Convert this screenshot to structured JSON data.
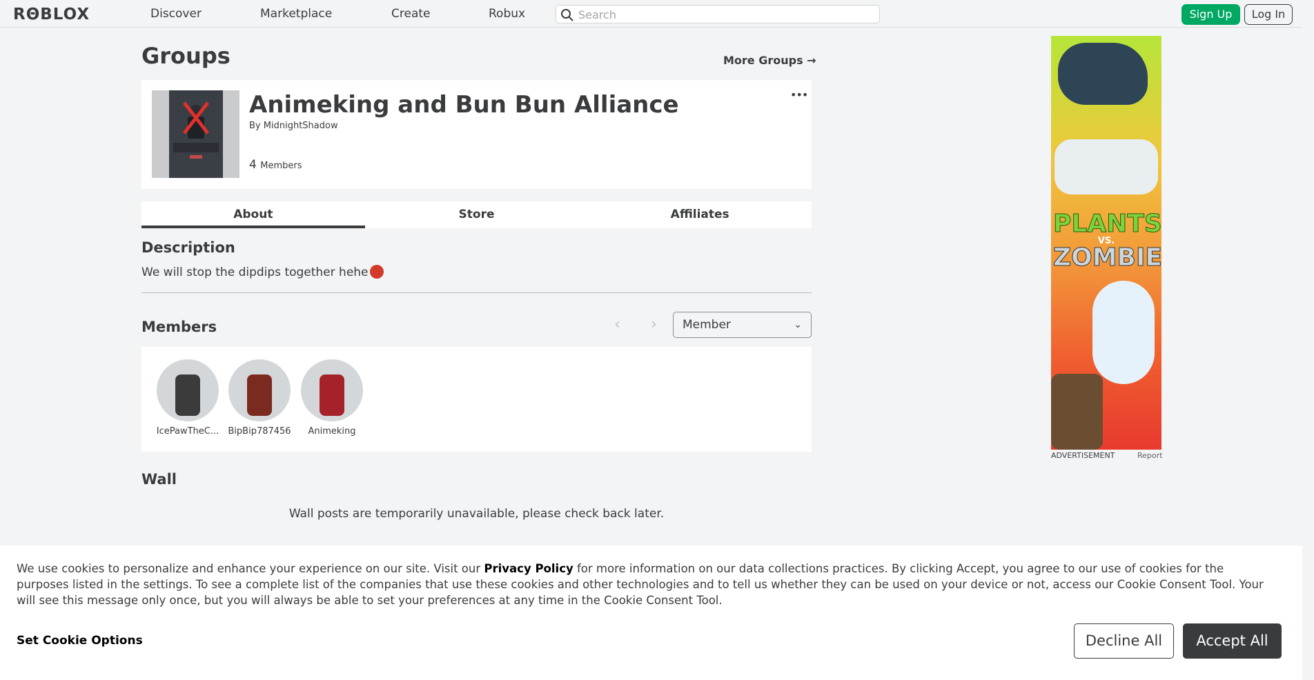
{
  "nav": {
    "logo": "RΘBLOX",
    "links": [
      "Discover",
      "Marketplace",
      "Create",
      "Robux"
    ],
    "search_placeholder": "Search",
    "signup": "Sign Up",
    "login": "Log In"
  },
  "page": {
    "title": "Groups",
    "more_groups": "More Groups →"
  },
  "group": {
    "name": "Animeking and Bun Bun Alliance",
    "by_label": "By",
    "owner": "MidnightShadow",
    "member_count": "4",
    "member_count_label": "Members",
    "more_menu": "•••"
  },
  "tabs": [
    "About",
    "Store",
    "Affiliates"
  ],
  "description": {
    "heading": "Description",
    "text": "We will stop the dipdips together hehe"
  },
  "members": {
    "heading": "Members",
    "prev": "‹",
    "next": "›",
    "role_selected": "Member",
    "list": [
      {
        "name": "IcePawTheC..."
      },
      {
        "name": "BipBip787456"
      },
      {
        "name": "Animeking"
      }
    ]
  },
  "wall": {
    "heading": "Wall",
    "message": "Wall posts are temporarily unavailable, please check back later."
  },
  "ad": {
    "title_line1": "PLANTS",
    "title_line2": "VS.",
    "title_line3": "ZOMBIES",
    "label": "ADVERTISEMENT",
    "report": "Report"
  },
  "cookie": {
    "text_before": "We use cookies to personalize and enhance your experience on our site. Visit our ",
    "privacy_link": "Privacy Policy",
    "text_after": " for more information on our data collections practices. By clicking Accept, you agree to our use of cookies for the purposes listed in the settings. To see a complete list of the companies that use these cookies and other technologies and to tell us whether they can be used on your device or not, access our Cookie Consent Tool. Your will see this message only once, but you will always be able to set your preferences at any time in the Cookie Consent Tool.",
    "options": "Set Cookie Options",
    "decline": "Decline All",
    "accept": "Accept All"
  },
  "colors": {
    "signup": "#00a862",
    "text": "#393b3d",
    "background": "#f2f4f5"
  }
}
